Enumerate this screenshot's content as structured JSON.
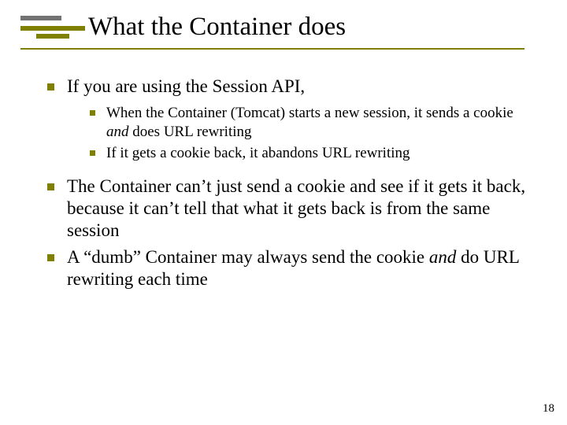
{
  "title": "What the Container does",
  "bullets": {
    "b1": "If you are using the Session API,",
    "b1_sub1_a": "When the Container (Tomcat) starts a new session, it sends a cookie ",
    "b1_sub1_em": "and",
    "b1_sub1_b": " does URL rewriting",
    "b1_sub2": "If it gets a cookie back, it abandons URL rewriting",
    "b2": "The Container can’t just send a cookie and see if it gets it back, because it can’t tell that what it gets back is from the same session",
    "b3_a": "A “dumb” Container may always send the cookie ",
    "b3_em": "and",
    "b3_b": " do URL rewriting each time"
  },
  "page_number": "18"
}
